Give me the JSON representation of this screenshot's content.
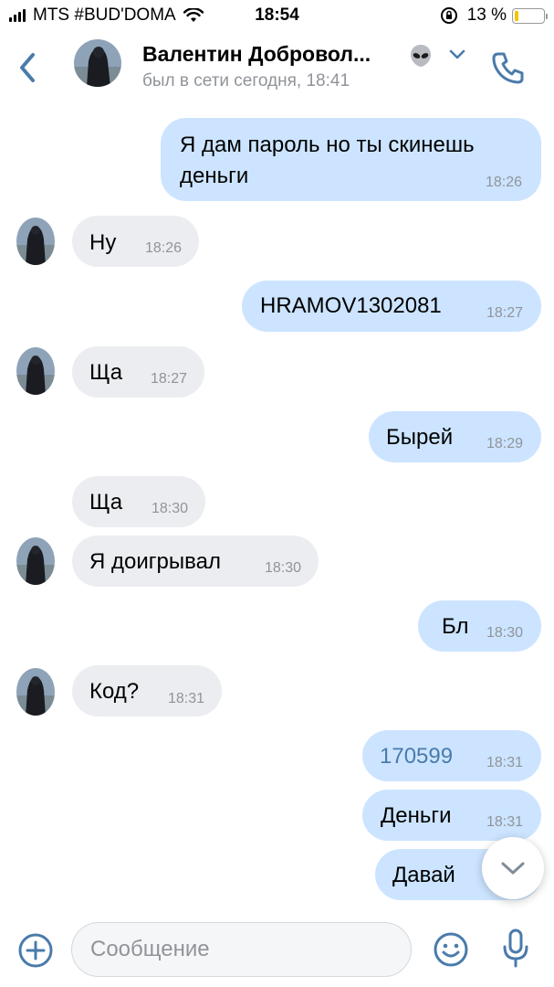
{
  "status_bar": {
    "carrier": "MTS #BUD'DOMA",
    "time": "18:54",
    "battery": "13 %",
    "battery_level": 0.13
  },
  "header": {
    "contact_name": "Валентин Добровол...",
    "status": "был в сети сегодня, 18:41",
    "emoji_icon": "alien-emoji",
    "accent": "#4a7bab"
  },
  "messages": [
    {
      "direction": "out",
      "lines": [
        "Я дам пароль но ты скинешь",
        "деньги"
      ],
      "time": "18:26"
    },
    {
      "direction": "in",
      "text": "Ну",
      "time": "18:26",
      "avatar": true
    },
    {
      "direction": "out",
      "text": "HRAMOV1302081",
      "time": "18:27"
    },
    {
      "direction": "in",
      "text": "Ща",
      "time": "18:27",
      "avatar": true
    },
    {
      "direction": "out",
      "text": "Бырей",
      "time": "18:29"
    },
    {
      "direction": "in",
      "text": "Ща",
      "time": "18:30",
      "avatar": false
    },
    {
      "direction": "in",
      "text": "Я доигрывал",
      "time": "18:30",
      "avatar": true
    },
    {
      "direction": "out",
      "text": "Бл",
      "time": "18:30"
    },
    {
      "direction": "in",
      "text": "Код?",
      "time": "18:31",
      "avatar": true
    },
    {
      "direction": "out",
      "text": "170599",
      "time": "18:31",
      "is_link": true
    },
    {
      "direction": "out",
      "text": "Деньги",
      "time": "18:31"
    },
    {
      "direction": "out",
      "text": "Давай",
      "time": ""
    }
  ],
  "composer": {
    "placeholder": "Сообщение",
    "value": ""
  },
  "colors": {
    "outgoing_bubble": "#cce4ff",
    "incoming_bubble": "#ebedf0",
    "icon_blue": "#4a7bab",
    "meta_gray": "#909499"
  }
}
